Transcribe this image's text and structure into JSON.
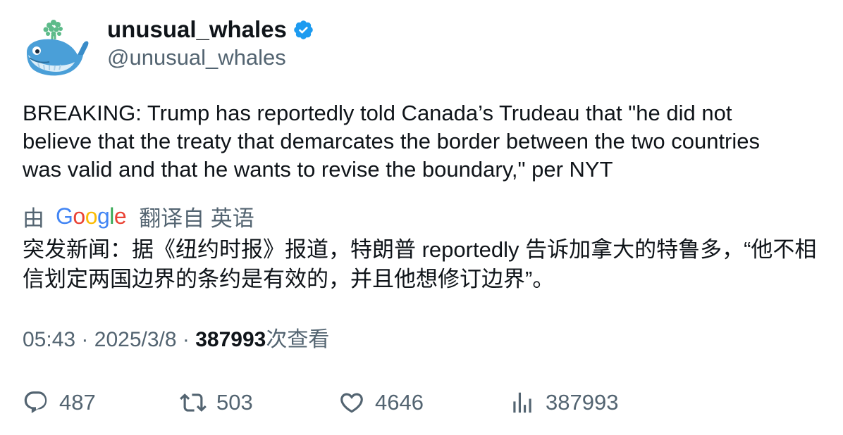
{
  "author": {
    "display_name": "unusual_whales",
    "handle": "@unusual_whales",
    "verified": true,
    "avatar_icon": "whale-icon"
  },
  "tweet": {
    "text": "BREAKING: Trump has reportedly told Canada’s Trudeau that \"he did not\nbelieve that the treaty that demarcates the border between the two countries\nwas valid and that he wants to revise the boundary,\" per NYT",
    "translation_prefix": "由",
    "translation_provider": "Google",
    "translation_suffix": "翻译自 英语",
    "translated_text": "突发新闻：据《纽约时报》报道，特朗普 reportedly 告诉加拿大的特鲁多，“他不相信划定两国边界的条约是有效的，并且他想修订边界”。"
  },
  "meta": {
    "time": "05:43",
    "separator": "·",
    "date": "2025/3/8",
    "views_count": "387993",
    "views_label": "次查看"
  },
  "actions": {
    "replies": "487",
    "retweets": "503",
    "likes": "4646",
    "views": "387993"
  },
  "colors": {
    "text_primary": "#0f1419",
    "text_secondary": "#536471",
    "verified_blue": "#1d9bf0"
  }
}
